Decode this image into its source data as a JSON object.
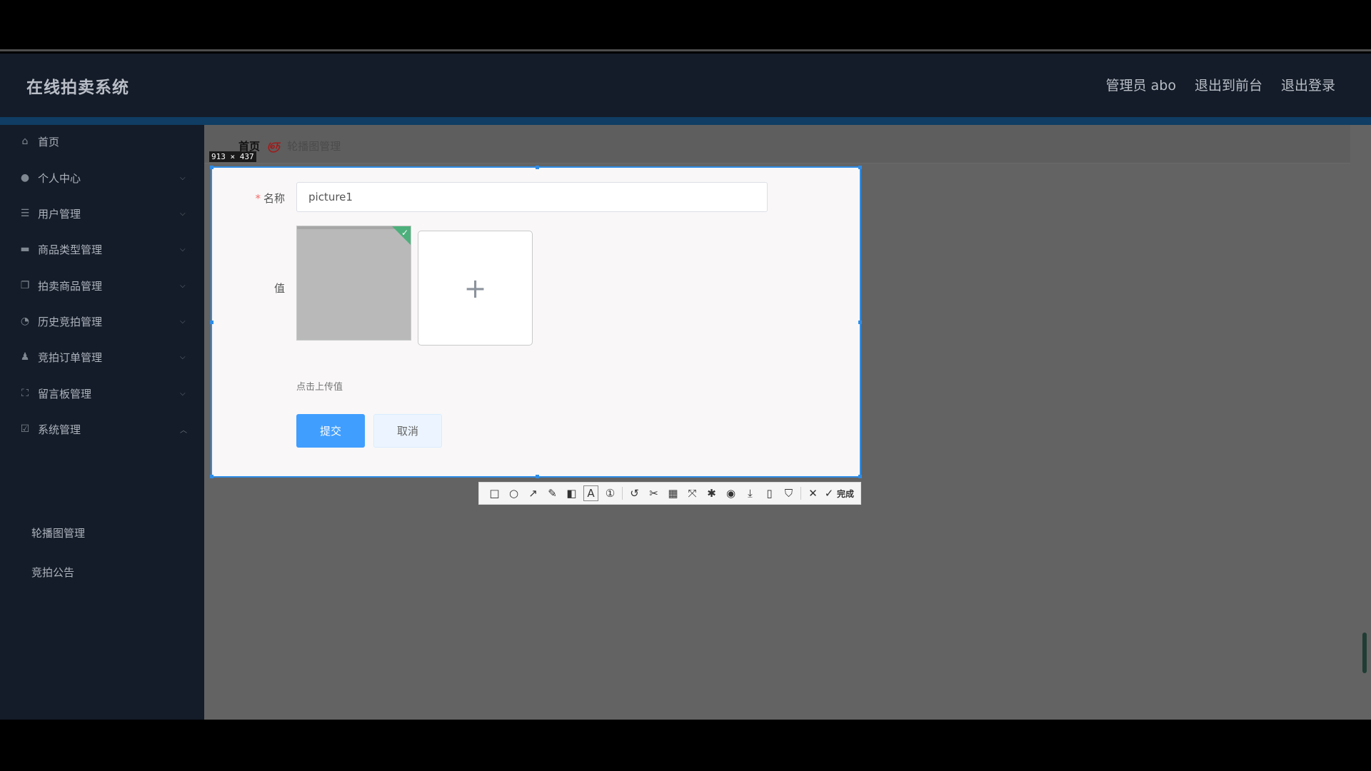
{
  "header": {
    "title": "在线拍卖系统",
    "nav": [
      "管理员 abo",
      "退出到前台",
      "退出登录"
    ]
  },
  "sidebar": {
    "items": [
      {
        "label": "首页",
        "icon": "home-icon",
        "chevron": false
      },
      {
        "label": "个人中心",
        "icon": "user-icon",
        "chevron": true
      },
      {
        "label": "用户管理",
        "icon": "sliders-icon",
        "chevron": true
      },
      {
        "label": "商品类型管理",
        "icon": "monitor-icon",
        "chevron": true
      },
      {
        "label": "拍卖商品管理",
        "icon": "copy-icon",
        "chevron": true
      },
      {
        "label": "历史竞拍管理",
        "icon": "compass-icon",
        "chevron": true
      },
      {
        "label": "竞拍订单管理",
        "icon": "person-icon",
        "chevron": true
      },
      {
        "label": "留言板管理",
        "icon": "fullscreen-icon",
        "chevron": true
      },
      {
        "label": "系统管理",
        "icon": "checkbox-icon",
        "chevron": true
      }
    ],
    "sub_items": [
      "轮播图管理",
      "竞拍公告"
    ]
  },
  "breadcrumb": {
    "home": "首页",
    "separator": "ஞ",
    "current": "轮播图管理"
  },
  "selection": {
    "size_label": "913 × 437"
  },
  "form": {
    "name_label": "名称",
    "required_mark": "*",
    "name_value": "picture1",
    "value_label": "值",
    "upload_plus": "+",
    "upload_hint": "点击上传值",
    "submit_label": "提交",
    "cancel_label": "取消"
  },
  "toolbar": {
    "tools": [
      {
        "name": "rectangle-tool",
        "glyph": "□"
      },
      {
        "name": "ellipse-tool",
        "glyph": "○"
      },
      {
        "name": "arrow-tool",
        "glyph": "↗"
      },
      {
        "name": "pencil-tool",
        "glyph": "✎"
      },
      {
        "name": "mosaic-tool",
        "glyph": "◧"
      },
      {
        "name": "text-tool",
        "glyph": "A",
        "active": true
      },
      {
        "name": "number-marker-tool",
        "glyph": "①"
      },
      {
        "name": "undo-tool",
        "glyph": "↺"
      },
      {
        "name": "scissor-tool",
        "glyph": "✂"
      },
      {
        "name": "ocr-tool",
        "glyph": "▦"
      },
      {
        "name": "capture-tool",
        "glyph": "⤧"
      },
      {
        "name": "pin-tool",
        "glyph": "✱"
      },
      {
        "name": "record-tool",
        "glyph": "◉"
      },
      {
        "name": "download-tool",
        "glyph": "⤓"
      },
      {
        "name": "save-device-tool",
        "glyph": "▯"
      },
      {
        "name": "bookmark-tool",
        "glyph": "⛉"
      },
      {
        "name": "close-tool",
        "glyph": "✕"
      },
      {
        "name": "confirm-tool",
        "glyph": "✓"
      }
    ],
    "done_label": "完成"
  },
  "colors": {
    "primary": "#409eff",
    "selection_border": "#2f8ce6",
    "sidebar_bg": "#141c29",
    "header_accent": "#0f3d63",
    "upload_success": "#4db07c",
    "required": "#f56c6c"
  }
}
